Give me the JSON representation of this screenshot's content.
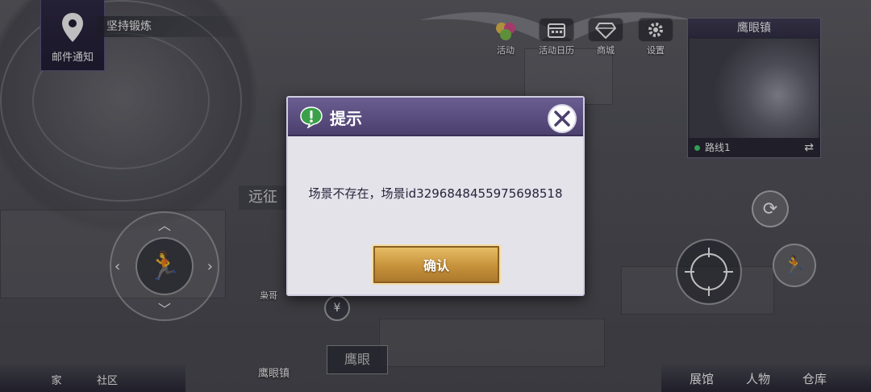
{
  "hud": {
    "mail_label": "邮件通知",
    "quest_title": "坚持锻炼",
    "top_buttons": [
      {
        "label": "活动",
        "icon": "balloons-icon"
      },
      {
        "label": "活动日历",
        "icon": "calendar-icon"
      },
      {
        "label": "商城",
        "icon": "diamond-icon"
      },
      {
        "label": "设置",
        "icon": "gear-icon"
      }
    ],
    "minimap": {
      "title": "鹰眼镇",
      "route_label": "路线1"
    },
    "map_labels": {
      "expedition": "远征",
      "npc": "枭哥",
      "town": "鹰眼镇",
      "eagle_eye": "鹰眼"
    },
    "bottom_left": [
      {
        "label": "家"
      },
      {
        "label": "社区"
      }
    ],
    "bottom_right": [
      {
        "label": "展馆"
      },
      {
        "label": "人物"
      },
      {
        "label": "仓库"
      }
    ]
  },
  "dialog": {
    "title": "提示",
    "message": "场景不存在，场景id3296848455975698518",
    "confirm_label": "确认"
  },
  "colors": {
    "dialog_header": "#5a4d80",
    "confirm_gold": "#c6913a",
    "alert_green": "#3aa04a"
  }
}
